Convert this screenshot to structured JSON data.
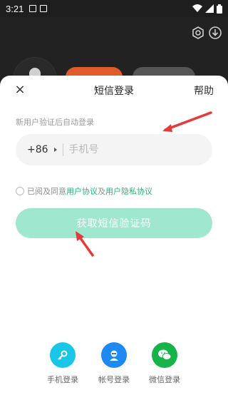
{
  "status_bar": {
    "time": "3:21"
  },
  "sheet": {
    "title": "短信登录",
    "close": "×",
    "help": "帮助",
    "hint": "新用户验证后自动登录",
    "country_code": "+86",
    "phone_placeholder": "手机号",
    "agreement_prefix": "已阅及同意",
    "agreement_link_user": "用户协议",
    "agreement_joiner": "及",
    "agreement_link_privacy": "用户隐私协议",
    "get_code_button": "获取短信验证码"
  },
  "login_options": [
    {
      "label": "手机登录",
      "icon": "key-icon",
      "color": "#19c6e6"
    },
    {
      "label": "帐号登录",
      "icon": "account-icon",
      "color": "#1e88f5"
    },
    {
      "label": "微信登录",
      "icon": "wechat-icon",
      "color": "#16b34a"
    }
  ],
  "colors": {
    "accent": "#22b57a",
    "button_disabled": "#9fe7cf",
    "arrow": "#e33b3b"
  }
}
